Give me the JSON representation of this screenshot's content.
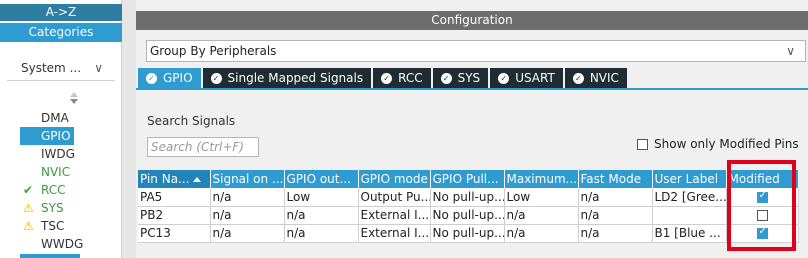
{
  "left_panel": {
    "tab_az": "A->Z",
    "tab_categories": "Categories",
    "system_dropdown": "System ...",
    "items": [
      {
        "label": "DMA",
        "state": "none"
      },
      {
        "label": "GPIO",
        "state": "selected"
      },
      {
        "label": "IWDG",
        "state": "none"
      },
      {
        "label": "NVIC",
        "state": "green"
      },
      {
        "label": "RCC",
        "state": "check"
      },
      {
        "label": "SYS",
        "state": "warn"
      },
      {
        "label": "TSC",
        "state": "warn"
      },
      {
        "label": "WWDG",
        "state": "none"
      }
    ]
  },
  "configuration": {
    "header": "Configuration",
    "group_select": "Group By Peripherals",
    "tabs": [
      "GPIO",
      "Single Mapped Signals",
      "RCC",
      "SYS",
      "USART",
      "NVIC"
    ],
    "search_label": "Search Signals",
    "search_placeholder": "Search (Ctrl+F)",
    "show_modified_label": "Show only Modified Pins"
  },
  "table": {
    "columns": [
      "Pin Na...",
      "Signal on ...",
      "GPIO out...",
      "GPIO mode",
      "GPIO Pull...",
      "Maximum...",
      "Fast Mode",
      "User Label",
      "Modified"
    ],
    "rows": [
      {
        "cells": [
          "PA5",
          "n/a",
          "Low",
          "Output Pu...",
          "No pull-up...",
          "Low",
          "n/a",
          "LD2 [Gree..."
        ],
        "modified": true
      },
      {
        "cells": [
          "PB2",
          "n/a",
          "n/a",
          "External I...",
          "No pull-up...",
          "n/a",
          "n/a",
          ""
        ],
        "modified": false
      },
      {
        "cells": [
          "PC13",
          "n/a",
          "n/a",
          "External I...",
          "No pull-up...",
          "n/a",
          "n/a",
          "B1 [Blue ..."
        ],
        "modified": true
      }
    ]
  },
  "colors": {
    "accent": "#2e9bd1",
    "tab_dark": "#1f2c33",
    "header_gray": "#6d6d6d",
    "highlight_red": "#e0001a"
  }
}
